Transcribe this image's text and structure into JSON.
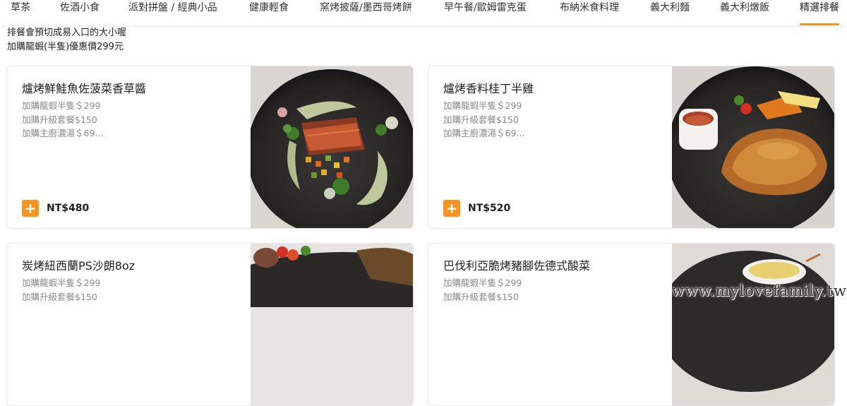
{
  "category_nav": {
    "items": [
      {
        "label": "草茶",
        "active": false
      },
      {
        "label": "佐酒小食",
        "active": false
      },
      {
        "label": "派對拼盤 / 經典小品",
        "active": false
      },
      {
        "label": "健康輕食",
        "active": false
      },
      {
        "label": "窯烤披薩/墨西哥烤餅",
        "active": false
      },
      {
        "label": "早午餐/歐姆雷克蛋",
        "active": false
      },
      {
        "label": "布納米食料理",
        "active": false
      },
      {
        "label": "義大利麵",
        "active": false
      },
      {
        "label": "義大利燉飯",
        "active": false
      },
      {
        "label": "精選排餐",
        "active": true
      }
    ],
    "accent_color": "#f7931e"
  },
  "notes": {
    "line1": "排餐會預切成易入口的大小喔",
    "line2": "加購龍蝦(半隻)優惠價299元"
  },
  "menu_items": [
    {
      "title": "爐烤鮮鮭魚佐菠菜香草醬",
      "desc": [
        "加購龍蝦半隻＄299",
        "加購升級套餐$150",
        "加購主廚濃湯＄69..."
      ],
      "price": "NT$480",
      "image": "salmon-dish"
    },
    {
      "title": "爐烤香料桂丁半雞",
      "desc": [
        "加購龍蝦半隻＄299",
        "加購升級套餐$150",
        "加購主廚濃湯＄69..."
      ],
      "price": "NT$520",
      "image": "roast-chicken-dish"
    },
    {
      "title": "炭烤紐西蘭PS沙朗8oz",
      "desc": [
        "加購龍蝦半隻＄299",
        "加購升級套餐$150"
      ],
      "price": "",
      "image": "sirloin-steak-dish"
    },
    {
      "title": "巴伐利亞脆烤豬腳佐德式酸菜",
      "desc": [
        "加購龍蝦半隻＄299",
        "加購升級套餐$150"
      ],
      "price": "",
      "image": "pork-knuckle-dish"
    }
  ],
  "add_icon": "plus-icon",
  "watermark": "www.mylovefamily.tw"
}
